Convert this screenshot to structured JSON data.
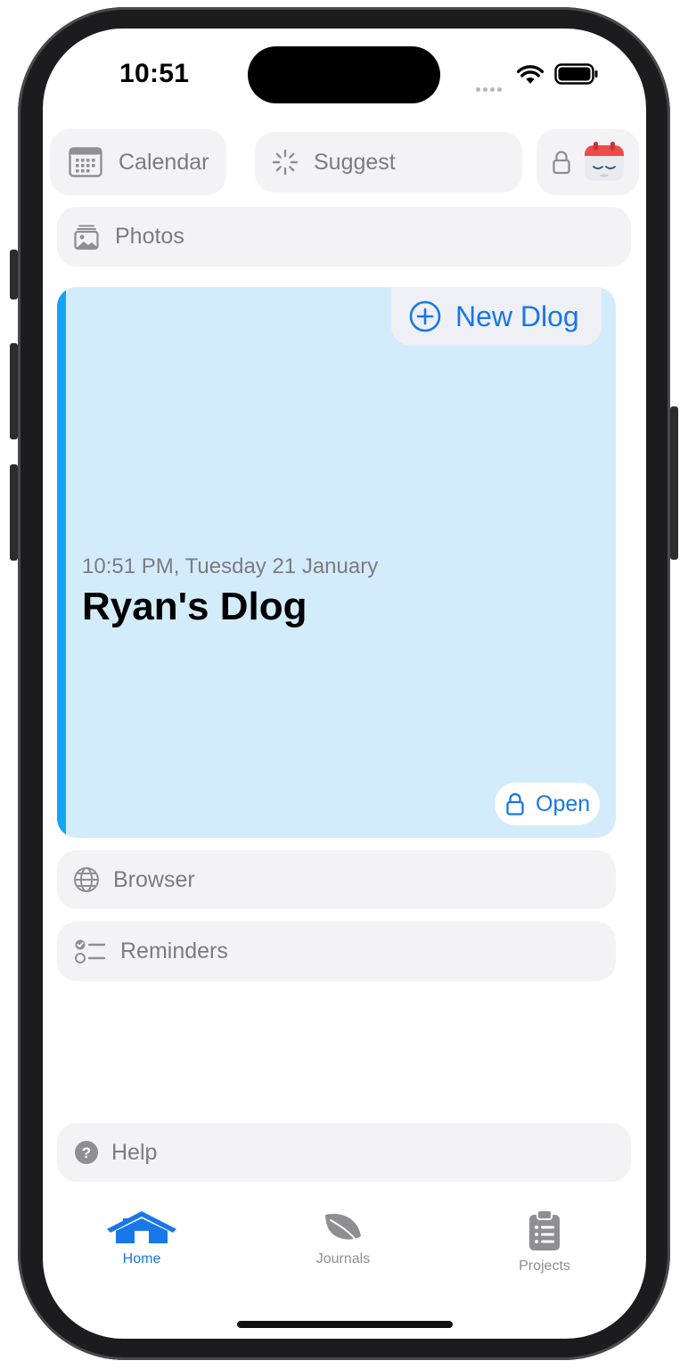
{
  "status_bar": {
    "time": "10:51"
  },
  "top_row": {
    "calendar_label": "Calendar",
    "suggest_label": "Suggest"
  },
  "photos": {
    "label": "Photos"
  },
  "card": {
    "new_label": "New Dlog",
    "timestamp": "10:51 PM, Tuesday 21 January",
    "title": "Ryan's Dlog",
    "open_label": "Open",
    "accent": "#12a4f6",
    "background": "#d3ecfb"
  },
  "browser": {
    "label": "Browser"
  },
  "reminders": {
    "label": "Reminders"
  },
  "help": {
    "label": "Help"
  },
  "tabs": [
    {
      "label": "Home",
      "icon": "house-icon",
      "active": true
    },
    {
      "label": "Journals",
      "icon": "leaf-icon",
      "active": false
    },
    {
      "label": "Projects",
      "icon": "clipboard-icon",
      "active": false
    }
  ],
  "colors": {
    "accent": "#1877e9",
    "muted": "#7c7c80"
  }
}
